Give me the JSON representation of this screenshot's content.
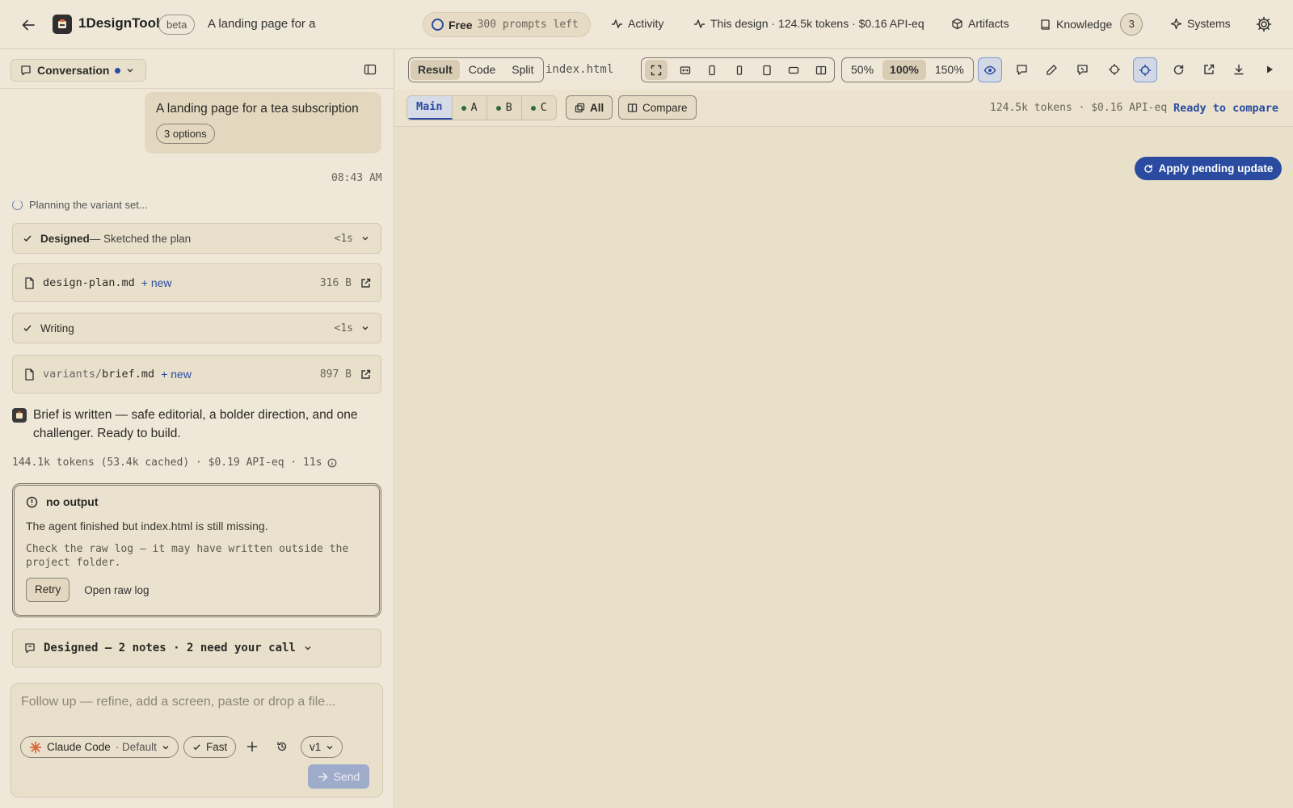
{
  "header": {
    "brand": "1DesignTool",
    "beta": "beta",
    "project_title": "A landing page for a",
    "plan": {
      "tier": "Free",
      "remaining": "300 prompts left"
    },
    "nav": {
      "activity": "Activity",
      "design_stats": "This design · 124.5k tokens · $0.16 API-eq",
      "artifacts": "Artifacts",
      "knowledge": "Knowledge",
      "knowledge_count": "3",
      "systems": "Systems"
    }
  },
  "sidebar": {
    "conversation_label": "Conversation",
    "user_message": "A landing page for a tea subscription",
    "options_chip": "3 options",
    "timestamp": "08:43 AM",
    "planning": "Planning the variant set...",
    "step_designed": {
      "title": "Designed",
      "detail": " — Sketched the plan",
      "duration": "<1s"
    },
    "file_plan": {
      "name": "design-plan.md",
      "tag": "+ new",
      "size": "316 B"
    },
    "step_writing": {
      "title": "Writing",
      "duration": "<1s"
    },
    "file_brief": {
      "dir": "variants/",
      "name": "brief.md",
      "tag": "+ new",
      "size": "897 B"
    },
    "assistant_message": "Brief is written — safe editorial, a bolder direction, and one challenger. Ready to build.",
    "stats": "144.1k tokens (53.4k cached) · $0.19 API-eq · 11s",
    "error": {
      "title": "no output",
      "message": "The agent finished but index.html is still missing.",
      "hint": "Check the raw log — it may have written outside the project folder.",
      "retry": "Retry",
      "open_log": "Open raw log"
    },
    "notes": "Designed — 2 notes · 2 need your call",
    "composer": {
      "placeholder": "Follow up — refine, add a screen, paste or drop a file...",
      "model": "Claude Code",
      "model_mode": "· Default",
      "speed": "Fast",
      "version": "v1",
      "send": "Send"
    }
  },
  "preview": {
    "view_modes": [
      "Result",
      "Code",
      "Split"
    ],
    "active_view": "Result",
    "filename": "index.html",
    "zoom_levels": [
      "50%",
      "100%",
      "150%"
    ],
    "active_zoom": "100%",
    "variants": [
      "Main",
      "A",
      "B",
      "C"
    ],
    "active_variant": "Main",
    "all_label": "All",
    "compare_label": "Compare",
    "stats": "124.5k tokens · $0.16 API-eq",
    "status": "Ready to compare",
    "apply_update": "Apply pending update"
  },
  "colors": {
    "accent": "#2a4ba0",
    "background": "#ece3cf",
    "panel": "#efe8d8",
    "variant_dot": "#2f6b3d",
    "claude_orange": "#d96a3d"
  }
}
